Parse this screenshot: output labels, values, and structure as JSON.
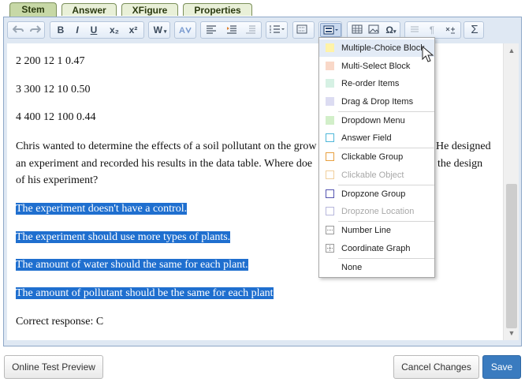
{
  "tabs": [
    "Stem",
    "Answer",
    "XFigure",
    "Properties"
  ],
  "toolbar": {
    "buttons": {
      "bold": "B",
      "italic": "I",
      "underline": "U",
      "subscript": "x₂",
      "superscript": "x²",
      "word": "W",
      "omega": "Ω",
      "pilcrow": "¶",
      "sigma": "Σ"
    }
  },
  "content": {
    "lines": [
      "2 200 12 1 0.47",
      "3 300 12 10 0.50",
      "4 400 12 100 0.44"
    ],
    "paragraph_lines": [
      "Chris wanted to determine the effects of a soil pollutant on the grow",
      "He designed",
      "an experiment and recorded his results in the data table. Where doe",
      "the design",
      "of his experiment?"
    ],
    "options": [
      "The experiment doesn't have a control.",
      "The experiment should use more types of plants.",
      "The amount of water should the same for each plant.",
      "The amount of pollutant should be the same for each plant"
    ],
    "correct": "Correct response: C"
  },
  "menu": {
    "items": [
      {
        "label": "Multiple-Choice Block",
        "color": "#fff3a8",
        "hover": true
      },
      {
        "label": "Multi-Select Block",
        "color": "#f9d8c8"
      },
      {
        "label": "Re-order Items",
        "color": "#d6f1e4"
      },
      {
        "label": "Drag & Drop Items",
        "color": "#dcdcf2"
      },
      {
        "label": "Dropdown Menu",
        "color": "#d2efc9"
      },
      {
        "label": "Answer Field",
        "color": "#4fb7d9"
      },
      {
        "label": "Clickable Group",
        "color": "#e8a040"
      },
      {
        "label": "Clickable Object",
        "color": "#f1cf9c",
        "disabled": true
      },
      {
        "label": "Dropzone Group",
        "color": "#5454b0"
      },
      {
        "label": "Dropzone Location",
        "color": "#b7b7dc",
        "disabled": true
      },
      {
        "label": "Number Line",
        "color": "#9a9a9a"
      },
      {
        "label": "Coordinate Graph",
        "color": "#9a9a9a"
      },
      {
        "label": "None",
        "color": ""
      }
    ]
  },
  "footer": {
    "preview": "Online Test Preview",
    "cancel": "Cancel Changes",
    "save": "Save"
  }
}
